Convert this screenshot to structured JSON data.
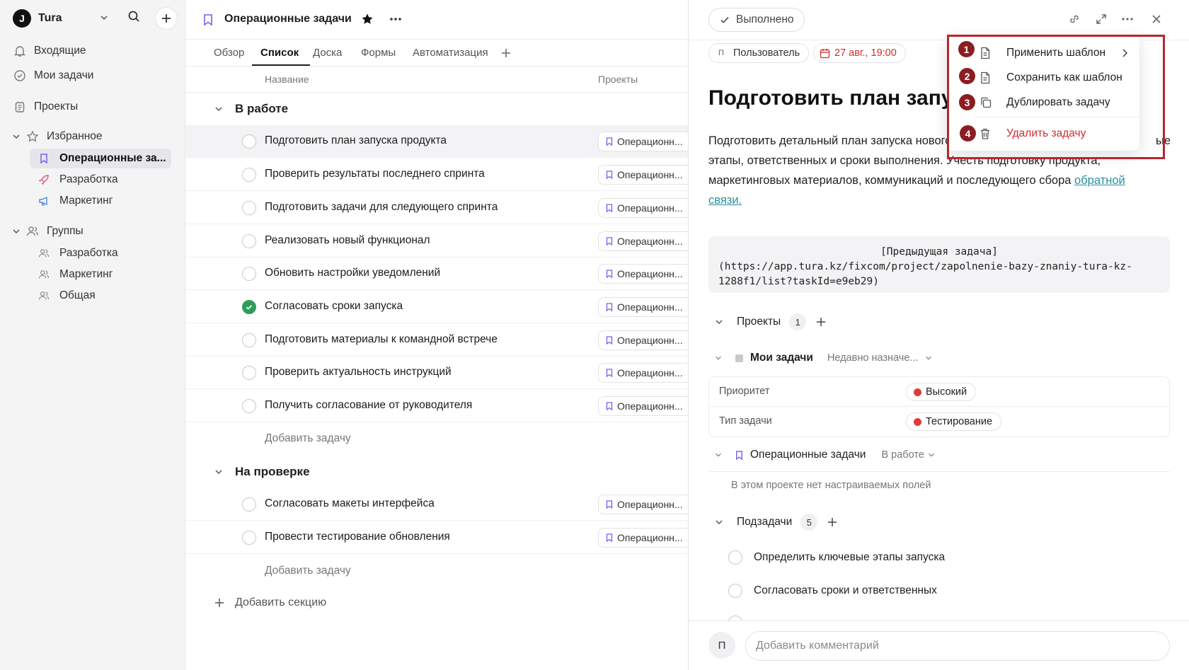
{
  "app": {
    "logo": "J",
    "workspace": "Tura"
  },
  "sidebar": {
    "inbox": "Входящие",
    "my_tasks": "Мои задачи",
    "projects": "Проекты",
    "favorites": {
      "label": "Избранное",
      "items": [
        {
          "label": "Операционные за...",
          "icon": "bookmark-icon",
          "color": "#7b5cf0"
        },
        {
          "label": "Разработка",
          "icon": "rocket-icon",
          "color": "#e05a8a"
        },
        {
          "label": "Маркетинг",
          "icon": "megaphone-icon",
          "color": "#4a8be0"
        }
      ]
    },
    "groups": {
      "label": "Группы",
      "items": [
        {
          "label": "Разработка"
        },
        {
          "label": "Маркетинг"
        },
        {
          "label": "Общая"
        }
      ]
    }
  },
  "project": {
    "title": "Операционные задачи",
    "tabs": [
      "Обзор",
      "Список",
      "Доска",
      "Формы",
      "Автоматизация"
    ],
    "active_tab": "Список",
    "columns": {
      "name": "Название",
      "projects": "Проекты"
    },
    "sections": [
      {
        "title": "В работе",
        "tasks": [
          {
            "name": "Подготовить план запуска продукта",
            "project": "Операционн...",
            "done": false,
            "highlighted": true
          },
          {
            "name": "Проверить результаты последнего спринта",
            "project": "Операционн...",
            "done": false
          },
          {
            "name": "Подготовить задачи для следующего спринта",
            "project": "Операционн...",
            "done": false
          },
          {
            "name": "Реализовать новый функционал",
            "project": "Операционн...",
            "done": false
          },
          {
            "name": "Обновить настройки уведомлений",
            "project": "Операционн...",
            "done": false
          },
          {
            "name": "Согласовать сроки запуска",
            "project": "Операционн...",
            "done": true
          },
          {
            "name": "Подготовить материалы к командной встрече",
            "project": "Операционн...",
            "done": false
          },
          {
            "name": "Проверить актуальность инструкций",
            "project": "Операционн...",
            "done": false
          },
          {
            "name": "Получить согласование от руководителя",
            "project": "Операционн...",
            "done": false
          }
        ],
        "add_task": "Добавить задачу"
      },
      {
        "title": "На проверке",
        "tasks": [
          {
            "name": "Согласовать макеты интерфейса",
            "project": "Операционн...",
            "done": false
          },
          {
            "name": "Провести тестирование обновления",
            "project": "Операционн...",
            "done": false
          }
        ],
        "add_task": "Добавить задачу"
      }
    ],
    "add_section": "Добавить секцию"
  },
  "detail": {
    "done_label": "Выполнено",
    "assignee_initial": "П",
    "assignee": "Пользователь",
    "due": "27 авг., 19:00",
    "title": "Подготовить план запуска",
    "description_lines": [
      "Подготовить детальный план запуска нового",
      "этапы, ответственных и сроки выполнения. Учесть подготовку продукта,",
      "маркетинговых материалов, коммуникаций и последующего сбора"
    ],
    "description_tail_right": "ые",
    "description_link_1": "обратной",
    "description_link_2": "связи.",
    "code_line1": "[Предыдущая задача]",
    "code_line2": "(https://app.tura.kz/fixcom/project/zapolnenie-bazy-znaniy-tura-kz-",
    "code_line3": "1288f1/list?taskId=e9eb29)",
    "projects_label": "Проекты",
    "projects_count": "1",
    "my_tasks_label": "Мои задачи",
    "my_tasks_status": "Недавно назначе...",
    "fields": [
      {
        "label": "Приоритет",
        "value": "Высокий",
        "color": "#e03b3b"
      },
      {
        "label": "Тип задачи",
        "value": "Тестирование",
        "color": "#e03b3b"
      }
    ],
    "op_project": "Операционные задачи",
    "op_status": "В работе",
    "no_fields": "В этом проекте нет настраиваемых полей",
    "subtasks_label": "Подзадачи",
    "subtasks_count": "5",
    "subtasks": [
      "Определить ключевые этапы запуска",
      "Согласовать сроки и ответственных"
    ],
    "comment_initial": "П",
    "comment_placeholder": "Добавить комментарий"
  },
  "menu": {
    "items": [
      {
        "num": "1",
        "label": "Применить шаблон",
        "icon": "template-icon"
      },
      {
        "num": "2",
        "label": "Сохранить как шаблон",
        "icon": "document-icon"
      },
      {
        "num": "3",
        "label": "Дублировать задачу",
        "icon": "copy-icon"
      },
      {
        "num": "4",
        "label": "Удалить задачу",
        "icon": "trash-icon"
      }
    ],
    "highlight_color": "#b8262f"
  }
}
